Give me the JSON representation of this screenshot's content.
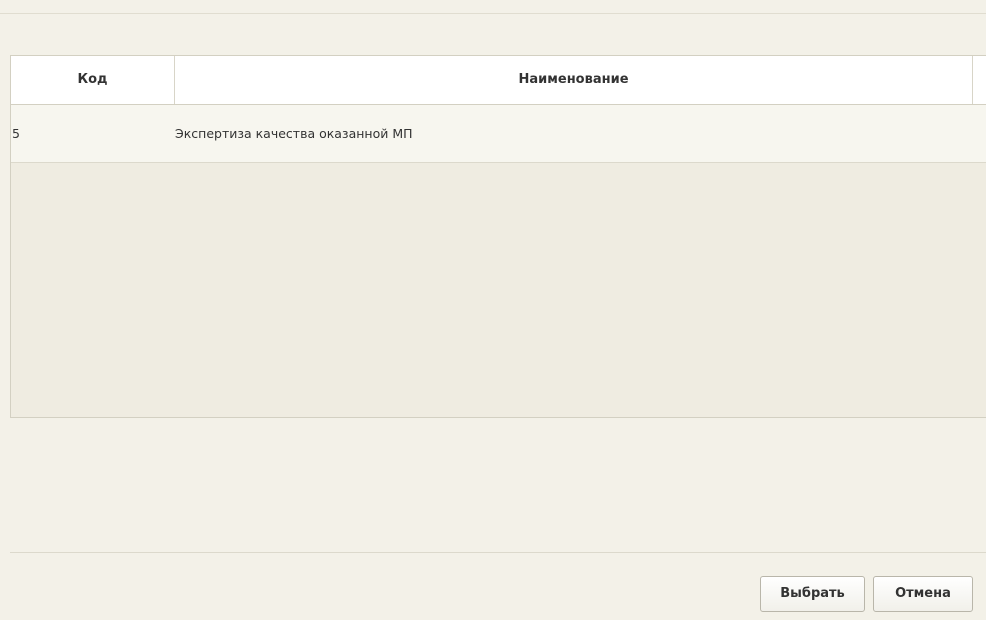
{
  "grid": {
    "columns": {
      "code": "Код",
      "name": "Наименование"
    },
    "rows": [
      {
        "code": "5",
        "name": "Экспертиза качества оказанной МП"
      }
    ]
  },
  "footer": {
    "select_label": "Выбрать",
    "cancel_label": "Отмена"
  },
  "colors": {
    "background": "#f3f1e8",
    "header_background": "#ffffff",
    "selected_row": "#f7f6ef"
  }
}
